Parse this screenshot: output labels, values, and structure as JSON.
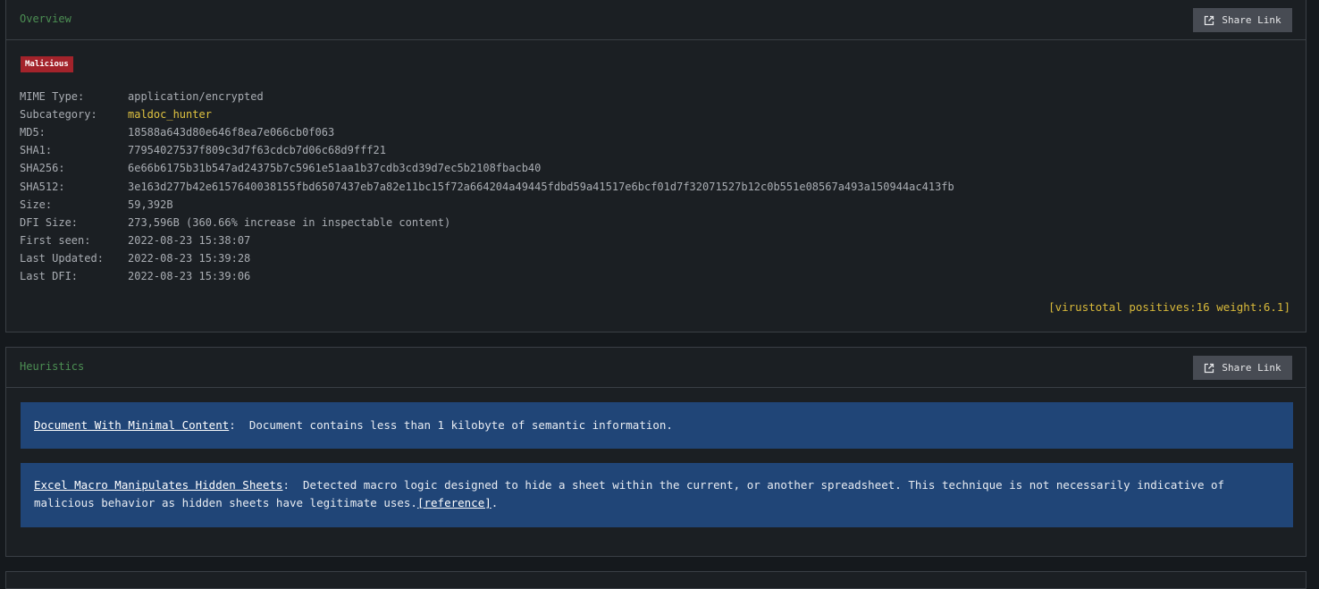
{
  "overview": {
    "title": "Overview",
    "share_label": "Share Link",
    "verdict": "Malicious",
    "fields": [
      {
        "key": "MIME Type:",
        "value": "application/encrypted"
      },
      {
        "key": "Subcategory:",
        "value": "maldoc_hunter"
      },
      {
        "key": "MD5:",
        "value": "18588a643d80e646f8ea7e066cb0f063"
      },
      {
        "key": "SHA1:",
        "value": "77954027537f809c3d7f63cdcb7d06c68d9fff21"
      },
      {
        "key": "SHA256:",
        "value": "6e66b6175b31b547ad24375b7c5961e51aa1b37cdb3cd39d7ec5b2108fbacb40"
      },
      {
        "key": "SHA512:",
        "value": "3e163d277b42e6157640038155fbd6507437eb7a82e11bc15f72a664204a49445fdbd59a41517e6bcf01d7f32071527b12c0b551e08567a493a150944ac413fb"
      },
      {
        "key": "Size:",
        "value": "59,392B"
      },
      {
        "key": "DFI Size:",
        "value": "273,596B (360.66% increase in inspectable content)"
      },
      {
        "key": "First seen:",
        "value": "2022-08-23 15:38:07"
      },
      {
        "key": "Last Updated:",
        "value": "2022-08-23 15:39:28"
      },
      {
        "key": "Last DFI:",
        "value": "2022-08-23 15:39:06"
      }
    ],
    "virustotal": "[virustotal positives:16 weight:6.1]"
  },
  "heuristics": {
    "title": "Heuristics",
    "share_label": "Share Link",
    "items": [
      {
        "name": "Document With Minimal Content",
        "separator": ":  ",
        "description": "Document contains less than 1 kilobyte of semantic information."
      },
      {
        "name": "Excel Macro Manipulates Hidden Sheets",
        "separator": ":  ",
        "description": "Detected macro logic designed to hide a sheet within the current, or another spreadsheet. This technique is not necessarily indicative of malicious behavior as hidden sheets have legitimate uses.",
        "reference": "[reference]",
        "trailing": "."
      }
    ]
  },
  "colors": {
    "panel_bg": "#1b1f23",
    "page_bg": "#15191d",
    "title_green": "#4c8f53",
    "badge_red": "#a3232b",
    "highlight_yellow": "#e0c341",
    "card_blue": "#204577",
    "button_gray": "#474b53"
  }
}
